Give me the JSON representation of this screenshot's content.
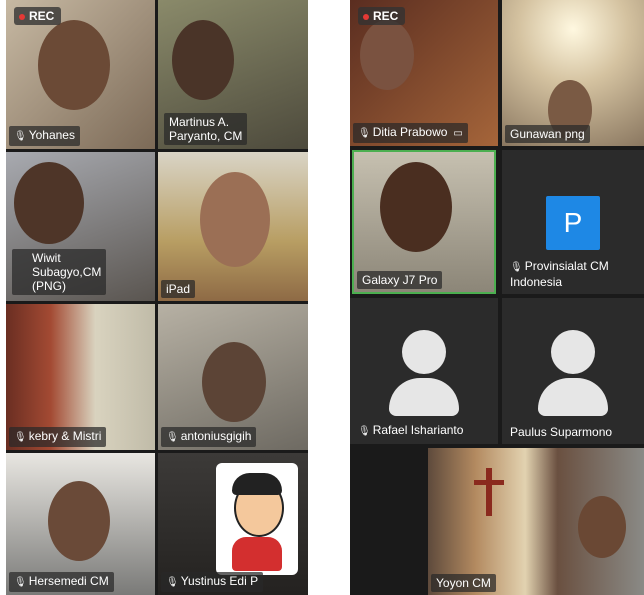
{
  "recording_badge": "REC",
  "left_grid": [
    {
      "name": "Yohanes",
      "mic": true
    },
    {
      "name": "Martinus A.\nParyanto, CM",
      "mic": false
    },
    {
      "name": "Wiwit\nSubagyo,CM\n(PNG)",
      "mic": true
    },
    {
      "name": "iPad",
      "mic": false
    },
    {
      "name": "kebry & Mistri",
      "mic": true
    },
    {
      "name": "antoniusgigih",
      "mic": true
    },
    {
      "name": "Hersemedi CM",
      "mic": true
    },
    {
      "name": "Yustinus Edi P",
      "mic": true
    }
  ],
  "right_grid": [
    {
      "name": "Ditia Prabowo",
      "mic": true,
      "video_off_icon": true
    },
    {
      "name": "Gunawan png",
      "mic": false
    },
    {
      "name": "Galaxy J7 Pro",
      "mic": false,
      "active_speaker": true
    },
    {
      "name": "Provinsialat CM\nIndonesia",
      "mic": true,
      "initial": "P"
    },
    {
      "name": "Rafael Isharianto",
      "mic": true
    },
    {
      "name": "Paulus Suparmono",
      "mic": false
    },
    {
      "name": "Yoyon CM",
      "mic": false
    }
  ],
  "colors": {
    "active_border": "#4caf50",
    "rec_dot": "#e53935",
    "initial_tile": "#1e88e5"
  }
}
